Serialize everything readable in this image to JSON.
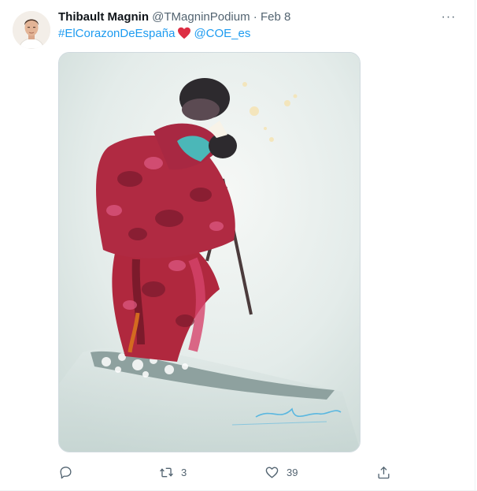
{
  "tweet": {
    "author_name": "Thibault Magnin",
    "handle": "@TMagninPodium",
    "separator": "·",
    "date": "Feb 8",
    "hashtag": "#ElCorazonDeEspaña",
    "mention": "@COE_es",
    "more_glyph": "···"
  },
  "actions": {
    "reply_count": "",
    "retweet_count": "3",
    "like_count": "39"
  },
  "colors": {
    "link": "#1d9bf0",
    "secondary_text": "#536471",
    "heart": "#e0245e"
  },
  "icons": [
    "more-icon",
    "heart-emoji-icon",
    "reply-icon",
    "retweet-icon",
    "like-icon",
    "share-icon"
  ]
}
